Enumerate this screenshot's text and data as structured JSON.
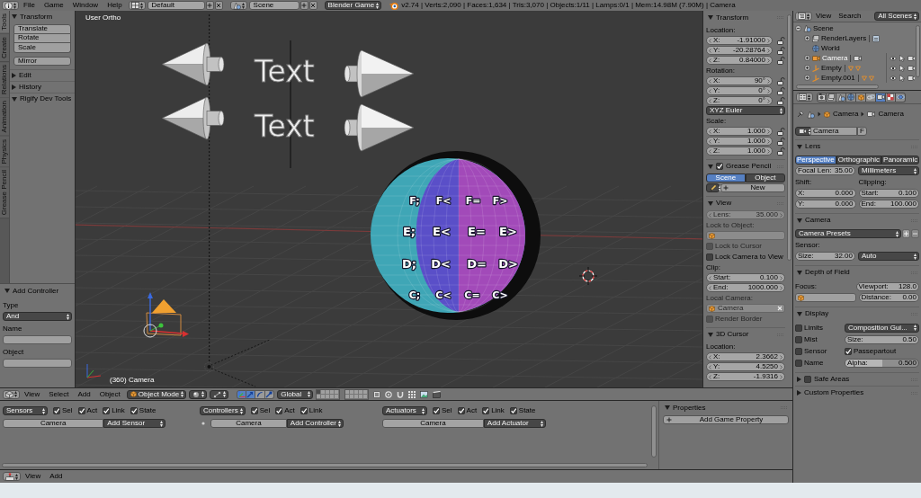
{
  "top_bar": {
    "menus": [
      "File",
      "Game",
      "Window",
      "Help"
    ],
    "layout": "Default",
    "scene": "Scene",
    "engine": "Blender Game",
    "stats": "v2.74 | Verts:2,090 | Faces:1,634 | Tris:3,070 | Objects:1/11 | Lamps:0/1 | Mem:14.98M (7.90M) | Camera"
  },
  "tool_shelf": {
    "tabs": [
      {
        "label": "Tools",
        "selected": true
      },
      {
        "label": "Create",
        "selected": false
      },
      {
        "label": "Relations",
        "selected": false
      },
      {
        "label": "Animation",
        "selected": false
      },
      {
        "label": "Physics",
        "selected": false
      },
      {
        "label": "Grease Pencil",
        "selected": false
      }
    ],
    "panels": [
      {
        "title": "Transform",
        "expanded": true,
        "button_groups": [
          [
            "Translate",
            "Rotate",
            "Scale"
          ],
          [
            "Mirror"
          ]
        ]
      },
      {
        "title": "Edit",
        "expanded": false
      },
      {
        "title": "History",
        "expanded": false
      },
      {
        "title": "Rigify Dev Tools",
        "expanded": true
      }
    ]
  },
  "operator_panel": {
    "title": "Add Controller",
    "expanded": true,
    "rows": [
      [
        {
          "kind": "label",
          "text": "Type"
        }
      ],
      [
        {
          "kind": "dropdown",
          "value": "And"
        }
      ],
      [
        {
          "kind": "label",
          "text": "Name"
        }
      ],
      [
        {
          "kind": "text_field"
        }
      ],
      [
        {
          "kind": "label",
          "text": "Object"
        }
      ],
      [
        {
          "kind": "text_field"
        }
      ]
    ]
  },
  "viewport": {
    "view_name": "User Ortho",
    "text_objects": [
      "Text",
      "Text"
    ],
    "sphere_labels": [
      [
        "F;",
        "F<",
        "F=",
        "F>"
      ],
      [
        "E;",
        "E<",
        "E=",
        "E>"
      ],
      [
        "D;",
        "D<",
        "D=",
        "D>"
      ],
      [
        "C;",
        "C<",
        "C=",
        "C>"
      ]
    ],
    "object_info": "(360) Camera"
  },
  "view_properties": {
    "sections": [
      {
        "title": "Transform",
        "expanded": true,
        "rows": [
          [
            {
              "kind": "label",
              "text": "Location:"
            }
          ],
          [
            {
              "kind": "number",
              "label": "X:",
              "value": "-1.91000",
              "locked": false
            }
          ],
          [
            {
              "kind": "number",
              "label": "Y:",
              "value": "-20.28764",
              "locked": false
            }
          ],
          [
            {
              "kind": "number",
              "label": "Z:",
              "value": "0.84000",
              "locked": false
            }
          ],
          [
            {
              "kind": "label",
              "text": "Rotation:"
            }
          ],
          [
            {
              "kind": "number",
              "label": "X:",
              "value": "90°",
              "locked": false
            }
          ],
          [
            {
              "kind": "number",
              "label": "Y:",
              "value": "0°",
              "locked": false
            }
          ],
          [
            {
              "kind": "number",
              "label": "Z:",
              "value": "0°",
              "locked": false
            }
          ],
          [
            {
              "kind": "dropdown",
              "value": "XYZ Euler"
            }
          ],
          [
            {
              "kind": "label",
              "text": "Scale:"
            }
          ],
          [
            {
              "kind": "number",
              "label": "X:",
              "value": "1.000",
              "locked": false
            }
          ],
          [
            {
              "kind": "number",
              "label": "Y:",
              "value": "1.000",
              "locked": false
            }
          ],
          [
            {
              "kind": "number",
              "label": "Z:",
              "value": "1.000",
              "locked": false
            }
          ]
        ]
      },
      {
        "title": "Grease Pencil",
        "expanded": true,
        "checked": true,
        "rows": [
          [
            {
              "kind": "toggle",
              "options": [
                {
                  "label": "Scene",
                  "selected": true
                },
                {
                  "label": "Object",
                  "selected": false
                }
              ]
            }
          ],
          [
            {
              "kind": "new_button",
              "label": "New"
            }
          ]
        ]
      },
      {
        "title": "View",
        "expanded": true,
        "rows": [
          [
            {
              "kind": "number",
              "label": "Lens:",
              "value": "35.000",
              "disabled": true
            }
          ],
          [
            {
              "kind": "label",
              "text": "Lock to Object:",
              "disabled": true
            }
          ],
          [
            {
              "kind": "object_field",
              "clearable": false,
              "disabled": true
            }
          ],
          [
            {
              "kind": "checkbox",
              "label": "Lock to Cursor",
              "checked": false,
              "disabled": true
            }
          ],
          [
            {
              "kind": "checkbox",
              "label": "Lock Camera to View",
              "checked": false,
              "disabled": false
            }
          ],
          [
            {
              "kind": "label",
              "text": "Clip:",
              "disabled": false
            }
          ],
          [
            {
              "kind": "number",
              "label": "Start:",
              "value": "0.100",
              "disabled": false
            }
          ],
          [
            {
              "kind": "number",
              "label": "End:",
              "value": "1000.000",
              "disabled": false
            }
          ],
          [
            {
              "kind": "label",
              "text": "Local Camera:",
              "disabled": true
            }
          ],
          [
            {
              "kind": "object_field",
              "value": "Camera",
              "clearable": true,
              "disabled": true
            }
          ],
          [
            {
              "kind": "checkbox",
              "label": "Render Border",
              "checked": false,
              "disabled": true
            }
          ]
        ]
      },
      {
        "title": "3D Cursor",
        "expanded": true,
        "rows": [
          [
            {
              "kind": "label",
              "text": "Location:"
            }
          ],
          [
            {
              "kind": "number",
              "label": "X:",
              "value": "2.3662"
            }
          ],
          [
            {
              "kind": "number",
              "label": "Y:",
              "value": "4.5250"
            }
          ],
          [
            {
              "kind": "number",
              "label": "Z:",
              "value": "-1.9316"
            }
          ]
        ]
      }
    ]
  },
  "outliner": {
    "menus": [
      "View",
      "Search"
    ],
    "display_mode": "All Scenes",
    "tree": [
      {
        "name": "Scene",
        "kind": "scene",
        "expanded": true,
        "selected": false,
        "children": [
          {
            "name": "RenderLayers",
            "kind": "render_layers",
            "expanded": false,
            "selected": false
          },
          {
            "name": "World",
            "kind": "world",
            "selected": false
          },
          {
            "name": "Camera",
            "kind": "camera",
            "expanded": false,
            "selected": true
          },
          {
            "name": "Empty",
            "kind": "empty",
            "expanded": false,
            "selected": false
          },
          {
            "name": "Empty.001",
            "kind": "empty",
            "expanded": false,
            "selected": false
          }
        ]
      }
    ]
  },
  "properties_editor": {
    "context_tabs": [
      {
        "selected": false
      },
      {
        "selected": false
      },
      {
        "selected": false
      },
      {
        "selected": false
      },
      {
        "selected": false
      },
      {
        "selected": false
      },
      {
        "selected": true
      },
      {
        "selected": false
      },
      {
        "selected": false
      }
    ],
    "breadcrumb": [
      "Camera",
      "Camera"
    ],
    "datablock": {
      "name": "Camera",
      "fake_user": "F"
    },
    "sections": [
      {
        "title": "Lens",
        "expanded": true,
        "rows": [
          [
            {
              "kind": "toggle",
              "options": [
                {
                  "label": "Perspective",
                  "selected": true
                },
                {
                  "label": "Orthographic",
                  "selected": false
                },
                {
                  "label": "Panoramic",
                  "selected": false
                }
              ]
            }
          ],
          [
            {
              "kind": "number",
              "label": "Focal Len:",
              "value": "35.00"
            },
            {
              "kind": "dropdown",
              "value": "Millimeters"
            }
          ],
          [
            {
              "kind": "label",
              "text": "Shift:"
            },
            {
              "kind": "label",
              "text": "Clipping:"
            }
          ],
          [
            {
              "kind": "number",
              "label": "X:",
              "value": "0.000"
            },
            {
              "kind": "number",
              "label": "Start:",
              "value": "0.100"
            }
          ],
          [
            {
              "kind": "number",
              "label": "Y:",
              "value": "0.000"
            },
            {
              "kind": "number",
              "label": "End:",
              "value": "100.000"
            }
          ]
        ]
      },
      {
        "title": "Camera",
        "expanded": true,
        "rows": [
          [
            {
              "kind": "preset_dropdown",
              "value": "Camera Presets"
            }
          ],
          [
            {
              "kind": "label",
              "text": "Sensor:"
            }
          ],
          [
            {
              "kind": "number",
              "label": "Size:",
              "value": "32.00"
            },
            {
              "kind": "dropdown",
              "value": "Auto"
            }
          ]
        ]
      },
      {
        "title": "Depth of Field",
        "expanded": true,
        "rows": [
          [
            {
              "kind": "label",
              "text": "Focus:"
            },
            {
              "kind": "number",
              "label": "Viewport:",
              "value": "128.0"
            }
          ],
          [
            {
              "kind": "object_field",
              "clearable": false
            },
            {
              "kind": "number",
              "label": "Distance:",
              "value": "0.00"
            }
          ]
        ]
      },
      {
        "title": "Display",
        "expanded": true,
        "rows": [
          [
            {
              "kind": "checkbox",
              "label": "Limits",
              "checked": false
            },
            {
              "kind": "dropdown",
              "value": "Composition Gui..."
            }
          ],
          [
            {
              "kind": "checkbox",
              "label": "Mist",
              "checked": false
            },
            {
              "kind": "number",
              "label": "Size:",
              "value": "0.50"
            }
          ],
          [
            {
              "kind": "checkbox",
              "label": "Sensor",
              "checked": false
            },
            {
              "kind": "checkbox",
              "label": "Passepartout",
              "checked": true
            }
          ],
          [
            {
              "kind": "checkbox",
              "label": "Name",
              "checked": false
            },
            {
              "kind": "slider",
              "label": "Alpha:",
              "value": "0.500",
              "level": 0.5
            }
          ]
        ]
      },
      {
        "title": "Safe Areas",
        "expanded": false,
        "checked": false
      },
      {
        "title": "Custom Properties",
        "expanded": false
      }
    ]
  },
  "view3d_header": {
    "menus": [
      "View",
      "Select",
      "Add",
      "Object"
    ],
    "mode": "Object Mode",
    "manipulators": [
      {
        "selected": true
      },
      {
        "selected": true
      },
      {
        "selected": false
      },
      {
        "selected": false
      }
    ],
    "orientation": "Global",
    "layers": [
      {
        "selected": true
      },
      {
        "selected": false
      },
      {
        "selected": false
      },
      {
        "selected": false
      },
      {
        "selected": false
      },
      {
        "selected": false
      },
      {
        "selected": false
      },
      {
        "selected": false
      },
      {
        "selected": false
      },
      {
        "selected": false
      },
      {
        "selected": false
      },
      {
        "selected": false
      },
      {
        "selected": false
      },
      {
        "selected": false
      },
      {
        "selected": false
      },
      {
        "selected": false
      },
      {
        "selected": false
      },
      {
        "selected": false
      },
      {
        "selected": false
      },
      {
        "selected": false
      }
    ]
  },
  "logic_editor": {
    "columns": [
      {
        "kind": "sensors",
        "menu": "Sensors",
        "filters": [
          {
            "label": "Sel",
            "checked": true
          },
          {
            "label": "Act",
            "checked": true
          },
          {
            "label": "Link",
            "checked": true
          },
          {
            "label": "State",
            "checked": true
          }
        ],
        "object": "Camera",
        "add": "Add Sensor"
      },
      {
        "kind": "controllers",
        "menu": "Controllers",
        "filters": [
          {
            "label": "Sel",
            "checked": true
          },
          {
            "label": "Act",
            "checked": true
          },
          {
            "label": "Link",
            "checked": true
          }
        ],
        "object": "Camera",
        "add": "Add Controller"
      },
      {
        "kind": "actuators",
        "menu": "Actuators",
        "filters": [
          {
            "label": "Sel",
            "checked": true
          },
          {
            "label": "Act",
            "checked": true
          },
          {
            "label": "Link",
            "checked": true
          },
          {
            "label": "State",
            "checked": true
          }
        ],
        "object": "Camera",
        "add": "Add Actuator"
      }
    ],
    "side_panel": {
      "title": "Properties",
      "expanded": true,
      "button": "Add Game Property"
    }
  },
  "logic_header": {
    "menus": [
      "View",
      "Add"
    ]
  }
}
